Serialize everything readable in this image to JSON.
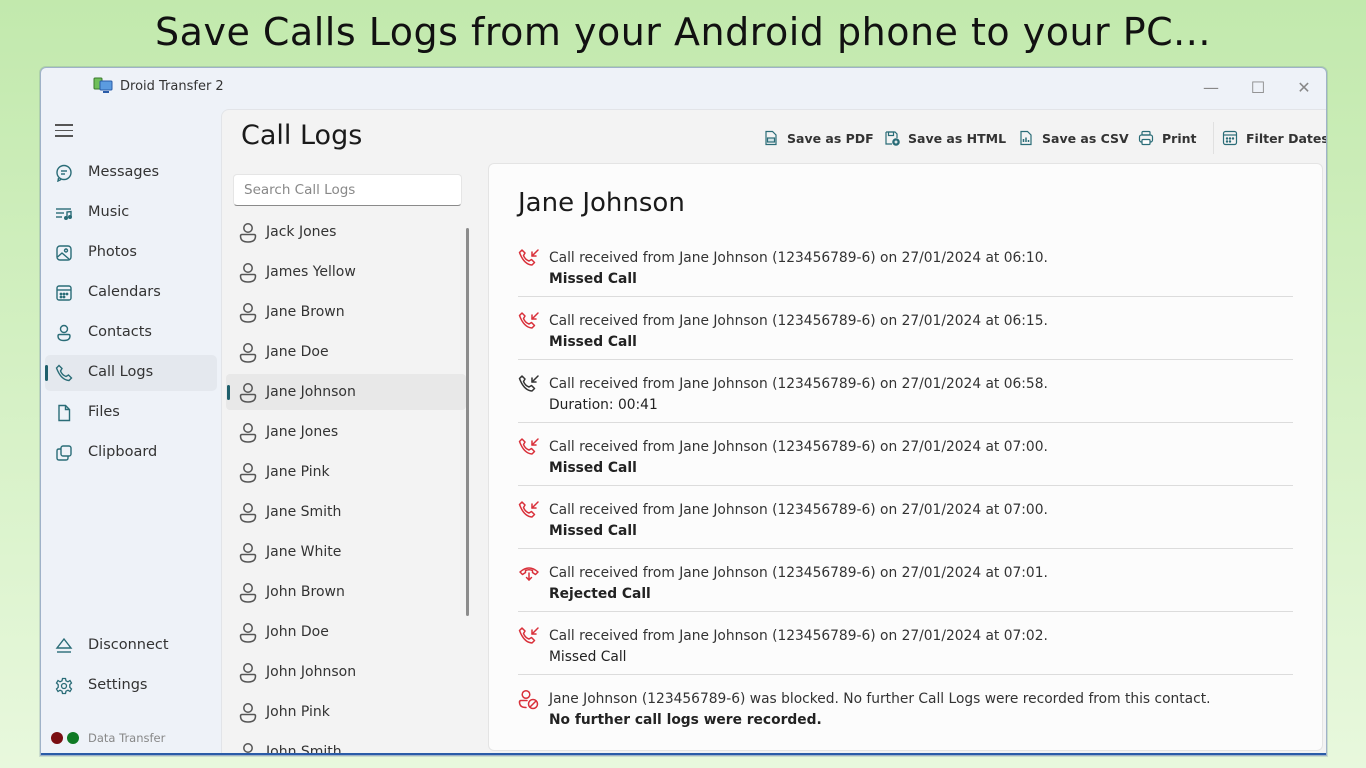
{
  "banner": "Save Calls Logs from your Android phone to your PC...",
  "window": {
    "title": "Droid Transfer 2",
    "controls": {
      "minimize": "—",
      "maximize": "☐",
      "close": "✕"
    }
  },
  "nav": {
    "items": [
      {
        "label": "Messages",
        "icon": "message-icon"
      },
      {
        "label": "Music",
        "icon": "music-icon"
      },
      {
        "label": "Photos",
        "icon": "photo-icon"
      },
      {
        "label": "Calendars",
        "icon": "calendar-icon"
      },
      {
        "label": "Contacts",
        "icon": "contact-icon"
      },
      {
        "label": "Call Logs",
        "icon": "phone-icon",
        "active": true
      },
      {
        "label": "Files",
        "icon": "file-icon"
      },
      {
        "label": "Clipboard",
        "icon": "clipboard-icon"
      }
    ],
    "footer": [
      {
        "label": "Disconnect",
        "icon": "eject-icon"
      },
      {
        "label": "Settings",
        "icon": "gear-icon"
      }
    ],
    "status": {
      "label": "Data Transfer",
      "dots": [
        "#7a0e12",
        "#0f7a24"
      ]
    }
  },
  "main": {
    "title": "Call Logs",
    "toolbar": [
      {
        "label": "Save as PDF",
        "icon": "pdf-icon"
      },
      {
        "label": "Save as HTML",
        "icon": "html-icon"
      },
      {
        "label": "Save as CSV",
        "icon": "csv-icon"
      },
      {
        "label": "Print",
        "icon": "print-icon"
      },
      {
        "label": "Filter Dates",
        "icon": "calendar-filter-icon"
      }
    ],
    "search": {
      "placeholder": "Search Call Logs",
      "value": ""
    },
    "contacts": [
      "Jack Jones",
      "James Yellow",
      "Jane Brown",
      "Jane Doe",
      "Jane Johnson",
      "Jane Jones",
      "Jane Pink",
      "Jane Smith",
      "Jane White",
      "John Brown",
      "John Doe",
      "John Johnson",
      "John Pink",
      "John Smith"
    ],
    "selected_contact": "Jane Johnson",
    "detail": {
      "name": "Jane Johnson",
      "logs": [
        {
          "type": "missed",
          "text": "Call received from Jane Johnson (123456789-6) on 27/01/2024 at 06:10.",
          "sub": "Missed Call",
          "bold": true
        },
        {
          "type": "missed",
          "text": "Call received from Jane Johnson (123456789-6) on 27/01/2024 at 06:15.",
          "sub": "Missed Call",
          "bold": true
        },
        {
          "type": "received",
          "text": "Call received from Jane Johnson (123456789-6) on 27/01/2024 at 06:58.",
          "sub": "Duration: 00:41",
          "bold": false
        },
        {
          "type": "missed",
          "text": "Call received from Jane Johnson (123456789-6) on 27/01/2024 at 07:00.",
          "sub": "Missed Call",
          "bold": true
        },
        {
          "type": "missed",
          "text": "Call received from Jane Johnson (123456789-6) on 27/01/2024 at 07:00.",
          "sub": "Missed Call",
          "bold": true
        },
        {
          "type": "rejected",
          "text": "Call received from Jane Johnson (123456789-6) on 27/01/2024 at 07:01.",
          "sub": "Rejected Call",
          "bold": true
        },
        {
          "type": "missed",
          "text": "Call received from Jane Johnson (123456789-6) on 27/01/2024 at 07:02.",
          "sub": "Missed Call",
          "bold": false
        },
        {
          "type": "blocked",
          "text": "Jane Johnson (123456789-6) was blocked. No further Call Logs were recorded from this contact.",
          "sub": "No further call logs were recorded.",
          "bold": true
        }
      ]
    },
    "colors": {
      "accent": "#1f5f6b",
      "missed": "#d9303a",
      "received": "#333333"
    }
  }
}
